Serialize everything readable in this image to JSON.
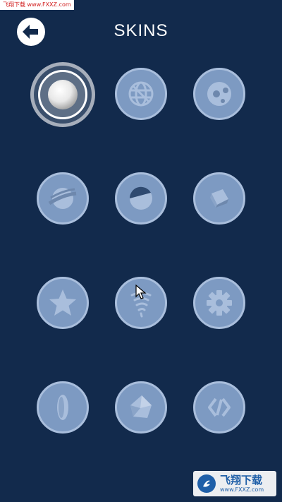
{
  "watermark_top": "飞翔下载 www.FXXZ.com",
  "header": {
    "back_icon": "arrow-left-icon",
    "title": "SKINS"
  },
  "skins": [
    {
      "icon": "white-ball-icon",
      "selected": true
    },
    {
      "icon": "wireframe-sphere-icon",
      "selected": false
    },
    {
      "icon": "soccer-ball-icon",
      "selected": false
    },
    {
      "icon": "planet-ring-icon",
      "selected": false
    },
    {
      "icon": "half-moon-icon",
      "selected": false
    },
    {
      "icon": "cube-icon",
      "selected": false
    },
    {
      "icon": "star-icon",
      "selected": false
    },
    {
      "icon": "tornado-icon",
      "selected": false
    },
    {
      "icon": "gear-icon",
      "selected": false
    },
    {
      "icon": "lens-disc-icon",
      "selected": false
    },
    {
      "icon": "polyhedron-icon",
      "selected": false
    },
    {
      "icon": "code-brackets-icon",
      "selected": false
    }
  ],
  "watermark_bottom": {
    "cn": "飞翔下载",
    "url": "www.FXXZ.com"
  },
  "colors": {
    "background": "#122a4c",
    "skin_fill": "#7d9ac2",
    "skin_border": "#a9bedc",
    "selected_ring": "#ffffff"
  }
}
